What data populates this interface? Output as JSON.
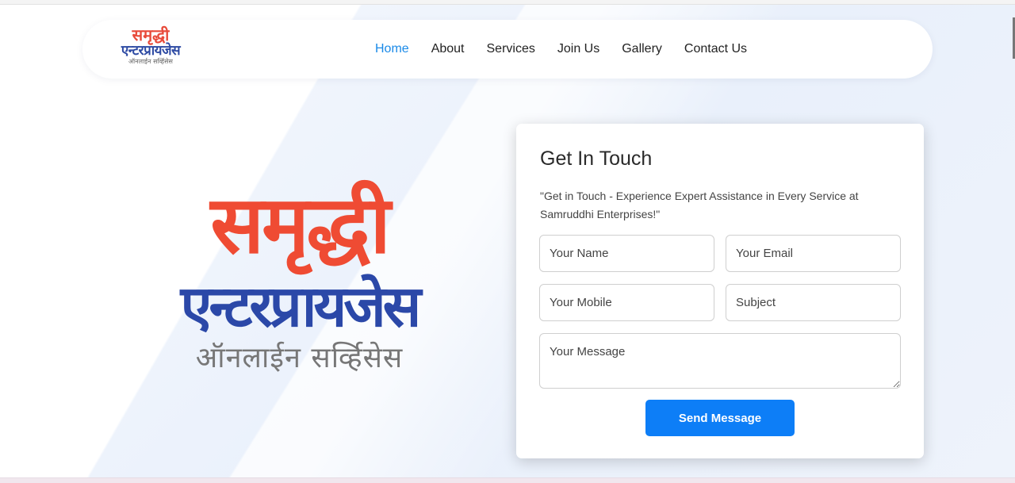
{
  "brand": {
    "line1": "समृद्धी",
    "line2": "एन्टरप्रायजेस",
    "line3": "ऑनलाईन सर्व्हिसेस"
  },
  "nav": {
    "items": [
      {
        "label": "Home",
        "active": true
      },
      {
        "label": "About",
        "active": false
      },
      {
        "label": "Services",
        "active": false
      },
      {
        "label": "Join Us",
        "active": false
      },
      {
        "label": "Gallery",
        "active": false
      },
      {
        "label": "Contact Us",
        "active": false
      }
    ]
  },
  "hero": {
    "line1": "समृद्धी",
    "line2": "एन्टरप्रायजेस",
    "line3": "ऑनलाईन सर्व्हिसेस"
  },
  "contact": {
    "title": "Get In Touch",
    "description": "\"Get in Touch - Experience Expert Assistance in Every Service at Samruddhi Enterprises!\"",
    "name_placeholder": "Your Name",
    "email_placeholder": "Your Email",
    "mobile_placeholder": "Your Mobile",
    "subject_placeholder": "Subject",
    "message_placeholder": "Your Message",
    "submit_label": "Send Message"
  },
  "colors": {
    "accent": "#0d7ef7",
    "nav_active": "#1a8ae8",
    "brand_red": "#ef4b33",
    "brand_blue": "#2b48a8"
  }
}
